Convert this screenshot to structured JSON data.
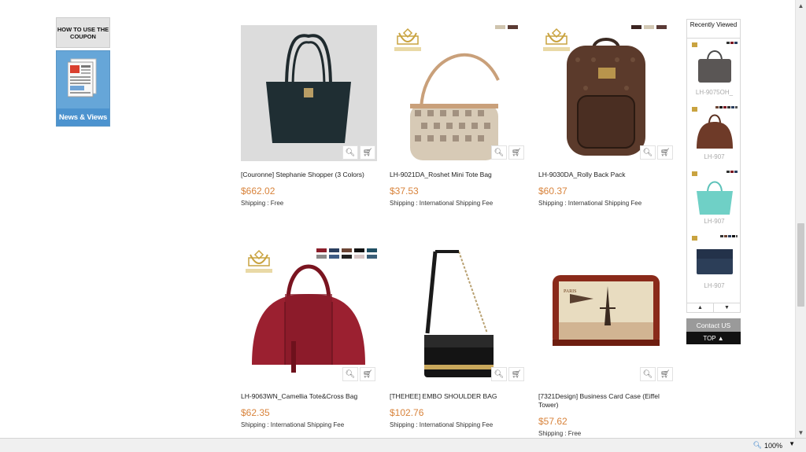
{
  "promos": {
    "coupon": "HOW TO USE THE COUPON",
    "news": "News & Views"
  },
  "products": [
    {
      "name": "[Couronne] Stephanie Shopper (3 Colors)",
      "price": "$662.02",
      "shipping": "Shipping : Free",
      "swatches": []
    },
    {
      "name": "LH-9021DA_Roshet Mini Tote Bag",
      "price": "$37.53",
      "shipping": "Shipping : International Shipping Fee",
      "swatches": [
        "#cfc4ae",
        "#5a3a33"
      ]
    },
    {
      "name": "LH-9030DA_Rolly Back Pack",
      "price": "$60.37",
      "shipping": "Shipping : International Shipping Fee",
      "swatches": [
        "#3b2420",
        "#d2c8b4",
        "#5a3a36"
      ]
    },
    {
      "name": "LH-9063WN_Camellia Tote&Cross Bag",
      "price": "$62.35",
      "shipping": "Shipping : International Shipping Fee",
      "swatches": [
        "#8b1e2b",
        "#2a3e5e",
        "#6b4434",
        "#111111",
        "#1f4e62",
        "#8a8a8a",
        "#3e5c86",
        "#222222",
        "#d6c4c4",
        "#3b5f78"
      ]
    },
    {
      "name": "[THEHEE] EMBO SHOULDER BAG",
      "price": "$102.76",
      "shipping": "Shipping : International Shipping Fee",
      "swatches": []
    },
    {
      "name": "[7321Design] Business Card Case (Eiffel Tower)",
      "price": "$57.62",
      "shipping": "Shipping : Free",
      "swatches": []
    }
  ],
  "recently_viewed": {
    "title": "Recently Viewed",
    "items": [
      {
        "code": "LH-9075OH_"
      },
      {
        "code": "LH-907"
      },
      {
        "code": "LH-907"
      },
      {
        "code": "LH-907"
      }
    ],
    "prev_icon": "▲",
    "next_icon": "▼"
  },
  "contact_label": "Contact US",
  "top_label": "TOP ▲",
  "status": {
    "zoom": "100%"
  },
  "icons": {
    "zoom": "magnifier-icon",
    "cart": "cart-icon"
  }
}
